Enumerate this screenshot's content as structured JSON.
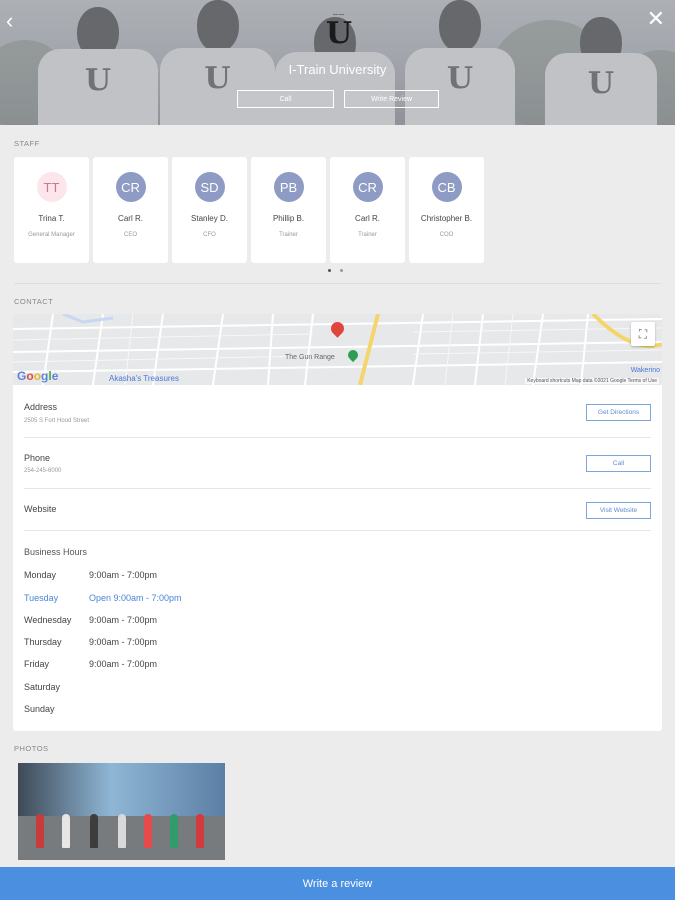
{
  "header": {
    "business_name": "I-Train University",
    "logo_text": "U",
    "call_label": "Call",
    "write_review_label": "Write Review"
  },
  "staff": {
    "section_label": "STAFF",
    "members": [
      {
        "initials": "TT",
        "name": "Trina T.",
        "role": "General Manager"
      },
      {
        "initials": "CR",
        "name": "Carl R.",
        "role": "CEO"
      },
      {
        "initials": "SD",
        "name": "Stanley D.",
        "role": "CFO"
      },
      {
        "initials": "PB",
        "name": "Phillip B.",
        "role": "Trainer"
      },
      {
        "initials": "CR",
        "name": "Carl R.",
        "role": "Trainer"
      },
      {
        "initials": "CB",
        "name": "Christopher B.",
        "role": "COO"
      }
    ]
  },
  "contact": {
    "section_label": "CONTACT",
    "map": {
      "place_label": "The Gun Range",
      "treasure_label": "Akasha's Treasures",
      "attribution": "Keyboard shortcuts   Map data ©2021 Google   Terms of Use",
      "wakerino_label": "Wakerino",
      "google_label": "Google"
    },
    "address": {
      "label": "Address",
      "value": "2505 S Fort Hood Street",
      "action": "Get Directions"
    },
    "phone": {
      "label": "Phone",
      "value": "254-245-6000",
      "action": "Call"
    },
    "website": {
      "label": "Website",
      "action": "Visit Website"
    },
    "hours": {
      "title": "Business Hours",
      "days": [
        {
          "day": "Monday",
          "hours": "9:00am - 7:00pm"
        },
        {
          "day": "Tuesday",
          "hours": "Open 9:00am - 7:00pm"
        },
        {
          "day": "Wednesday",
          "hours": "9:00am - 7:00pm"
        },
        {
          "day": "Thursday",
          "hours": "9:00am - 7:00pm"
        },
        {
          "day": "Friday",
          "hours": "9:00am - 7:00pm"
        },
        {
          "day": "Saturday",
          "hours": ""
        },
        {
          "day": "Sunday",
          "hours": ""
        }
      ]
    }
  },
  "photos": {
    "section_label": "PHOTOS"
  },
  "footer": {
    "write_review_label": "Write a review"
  },
  "colors": {
    "accent": "#4a8fe0",
    "today": "#4a84d6",
    "avatar": "#8e9bc4"
  }
}
